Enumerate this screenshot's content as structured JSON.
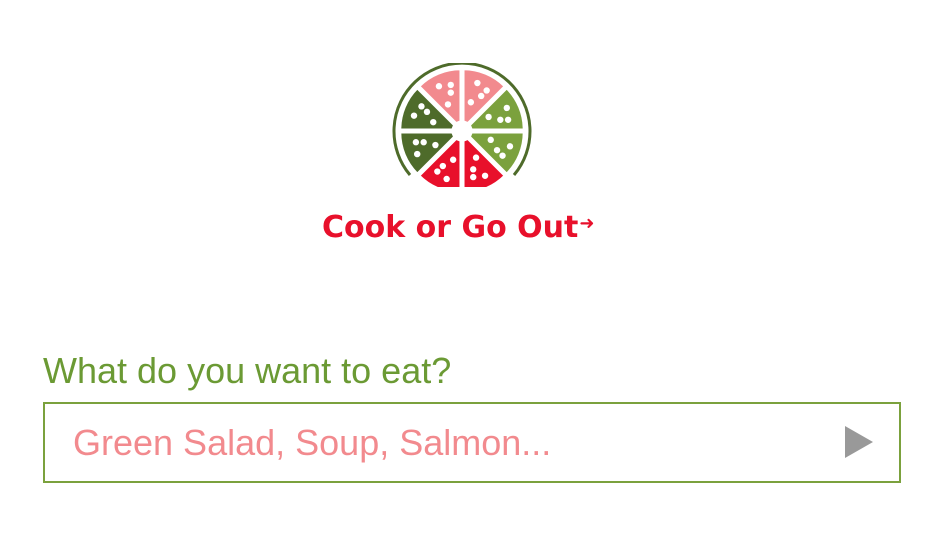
{
  "brand": {
    "name": "Cook or Go Out",
    "arrow_glyph": "➜",
    "logo_icon": "citrus-pizza-wheel-icon",
    "colors": {
      "red": "#e8102b",
      "pink": "#f28a8e",
      "olive": "#4e6b2a",
      "green": "#7ba13d"
    }
  },
  "search": {
    "question": "What do you want to eat?",
    "placeholder": "Green Salad, Soup, Salmon...",
    "value": "",
    "submit_icon": "play-arrow-icon",
    "border_color": "#7ba13d",
    "label_color": "#6b9a34",
    "placeholder_color": "#f28a8e"
  }
}
